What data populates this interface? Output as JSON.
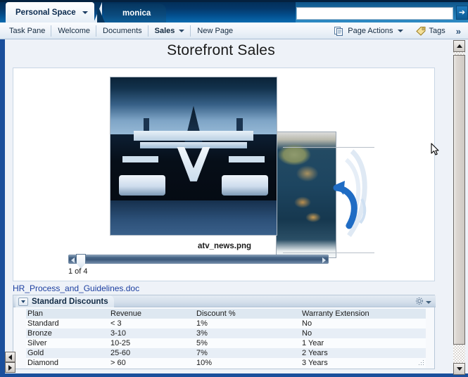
{
  "banner": {
    "tabs": [
      {
        "label": "Personal Space",
        "active": true,
        "has_caret": true
      },
      {
        "label": "monica",
        "active": false,
        "has_caret": false
      }
    ],
    "search": {
      "value": "",
      "placeholder": ""
    },
    "go_button_label": "➔"
  },
  "toolbar": {
    "left_items": [
      {
        "label": "Task Pane",
        "bold": false,
        "caret": false
      },
      {
        "label": "Welcome",
        "bold": false,
        "caret": false
      },
      {
        "label": "Documents",
        "bold": false,
        "caret": false
      },
      {
        "label": "Sales",
        "bold": true,
        "caret": true
      },
      {
        "label": "New Page",
        "bold": false,
        "caret": false
      }
    ],
    "right_items": [
      {
        "label": "Page Actions",
        "icon": "pages-icon",
        "caret": true
      },
      {
        "label": "Tags",
        "icon": "tag-icon",
        "caret": false
      }
    ],
    "overflow_label": "»"
  },
  "page": {
    "title": "Storefront Sales",
    "image_caption": "atv_news.png",
    "slider_position_label": "1 of 4",
    "document_link": "HR_Process_and_Guidelines.doc"
  },
  "panel": {
    "title": "Standard Discounts",
    "toggle_icon": "chevron-down-icon",
    "menu_icon": "gear-icon",
    "columns": [
      "Plan",
      "Revenue",
      "Discount %",
      "Warranty Extension"
    ],
    "rows": [
      {
        "plan": "Standard",
        "revenue": "< 3",
        "discount": "1%",
        "warranty": "No"
      },
      {
        "plan": "Bronze",
        "revenue": "3-10",
        "discount": "3%",
        "warranty": "No"
      },
      {
        "plan": "Silver",
        "revenue": "10-25",
        "discount": "5%",
        "warranty": "1 Year"
      },
      {
        "plan": "Gold",
        "revenue": "25-60",
        "discount": "7%",
        "warranty": "2 Years"
      },
      {
        "plan": "Diamond",
        "revenue": "> 60",
        "discount": "10%",
        "warranty": "3 Years"
      }
    ]
  },
  "colors": {
    "banner_dark": "#022c54",
    "banner_light": "#0b6bb0",
    "frame_blue": "#1b4f9c",
    "link_blue": "#1c3fa0",
    "content_bg": "#eef2f8",
    "row_even": "#e7eef6",
    "row_odd": "#fafcfe",
    "header_row": "#dee8f1"
  }
}
